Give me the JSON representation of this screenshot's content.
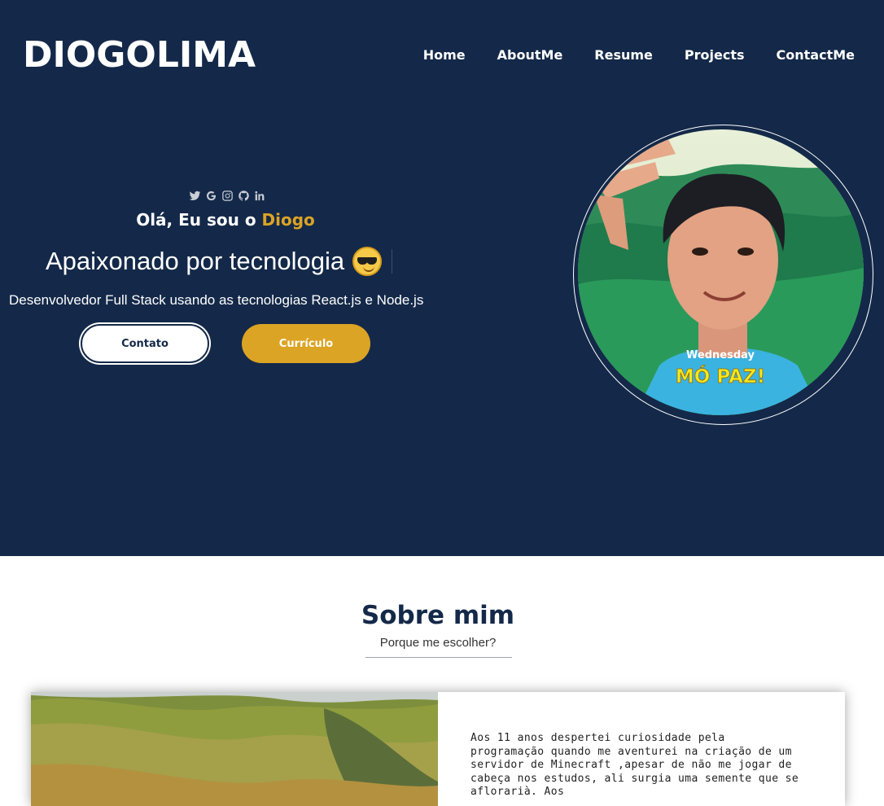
{
  "header": {
    "logo": "DIOGOLIMA",
    "nav": [
      "Home",
      "AboutMe",
      "Resume",
      "Projects",
      "ContactMe"
    ]
  },
  "hero": {
    "social_icons": [
      "twitter-icon",
      "google-icon",
      "instagram-icon",
      "github-icon",
      "linkedin-icon"
    ],
    "greeting_prefix": "Olá, Eu sou o ",
    "greeting_name": "Diogo",
    "tagline": "Apaixonado por tecnologia",
    "tagline_emoji": "smiling-face-with-sunglasses-emoji",
    "subtitle": "Desenvolvedor Full Stack usando as tecnologias React.js e Node.js",
    "contact_button": "Contato",
    "resume_button": "Currículo",
    "photo_caption_small": "Wednesday",
    "photo_caption_big": "MÓ PAZ!"
  },
  "about": {
    "title": "Sobre mim",
    "subtitle": "Porque me escolher?",
    "text": "Aos 11 anos despertei curiosidade pela programação quando me aventurei na criação de um servidor de Minecraft ,apesar de não me jogar de cabeça nos estudos, ali surgia uma semente que se aflorarià. Aos"
  },
  "colors": {
    "navy": "#142949",
    "gold": "#dca424",
    "white": "#ffffff"
  }
}
